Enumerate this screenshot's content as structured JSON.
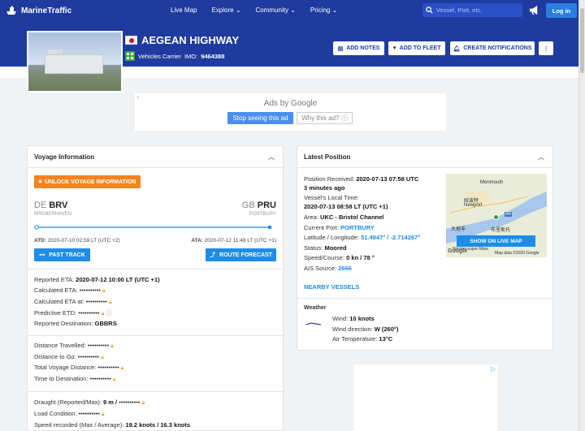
{
  "header": {
    "logo_text": "MarineTraffic",
    "nav": [
      "Live Map",
      "Explore",
      "Community",
      "Pricing"
    ],
    "search_placeholder": "Vessel, Port, etc.",
    "login_label": "Log in"
  },
  "vessel": {
    "name": "AEGEAN HIGHWAY",
    "type": "Vehicles Carrier",
    "imo_label": "IMO:",
    "imo": "9464388",
    "buttons": {
      "add_notes": "ADD NOTES",
      "add_to_fleet": "ADD TO FLEET",
      "create_notifications": "CREATE NOTIFICATIONS"
    }
  },
  "ad": {
    "ads_by": "Ads by Google",
    "stop": "Stop seeing this ad",
    "why": "Why this ad?"
  },
  "voyage": {
    "title": "Voyage Information",
    "unlock": "UNLOCK VOYAGE INFORMATION",
    "departure": {
      "country": "DE",
      "code": "BRV",
      "name": "BREMERHAVEN"
    },
    "arrival": {
      "country": "GB",
      "code": "PRU",
      "name": "PORTBURY"
    },
    "progress": 1.0,
    "atd_label": "ATD:",
    "atd": "2020-07-10 02:59 LT (UTC +2)",
    "ata_label": "ATA:",
    "ata": "2020-07-12 11:48 LT (UTC +1)",
    "past_track": "PAST TRACK",
    "route_forecast": "ROUTE FORECAST",
    "reported_eta_label": "Reported ETA:",
    "reported_eta": "2020-07-12 10:00 LT (UTC +1)",
    "calc_eta_label": "Calculated ETA:",
    "calc_eta_at_label": "Calculated ETA at:",
    "predictive_etd_label": "Predictive ETD:",
    "reported_dest_label": "Reported Destination:",
    "reported_dest": "GBBRS",
    "distance_travelled_label": "Distance Travelled:",
    "distance_to_go_label": "Distance to Go:",
    "total_distance_label": "Total Voyage Distance:",
    "time_to_dest_label": "Time to Destination:",
    "draught_label": "Draught (Reported/Max):",
    "draught": "9 m /",
    "load_label": "Load Condition:",
    "speed_label": "Speed recorded (Max / Average):",
    "speed": "19.2 knots / 16.3 knots",
    "masked": "••••••••••"
  },
  "position": {
    "title": "Latest Position",
    "received_label": "Position Received:",
    "received": "2020-07-13 07:58 UTC",
    "received_ago": "3 minutes ago",
    "local_time_label": "Vessel's Local Time:",
    "local_time": "2020-07-13 08:58 LT (UTC +1)",
    "area_label": "Area:",
    "area": "UKC - Bristol Channel",
    "current_port_label": "Current Port:",
    "current_port": "PORTBURY",
    "latlon_label": "Latitude / Longitude:",
    "latlon": "51.4947° / -2.714267°",
    "status_label": "Status:",
    "status": "Moored",
    "speed_course_label": "Speed/Course:",
    "speed_course": "0 kn / 78 °",
    "ais_source_label": "AIS Source:",
    "ais_source": "2666",
    "nearby": "NEARBY VESSELS",
    "map_button": "SHOW ON LIVE MAP",
    "map_labels": {
      "town1": "紐波特",
      "town2": "Newport",
      "town3": "Monmouth",
      "town4": "大地丰",
      "town5": "布里斯托",
      "town6": "Weston-super-Mare",
      "road": "M4",
      "google": "Google",
      "attribution": "Map data ©2020 Google"
    }
  },
  "weather": {
    "title": "Weather",
    "wind_label": "Wind:",
    "wind": "10 knots",
    "direction_label": "Wind direction:",
    "direction": "W (260°)",
    "temp_label": "Air Temperature:",
    "temp": "13°C"
  }
}
